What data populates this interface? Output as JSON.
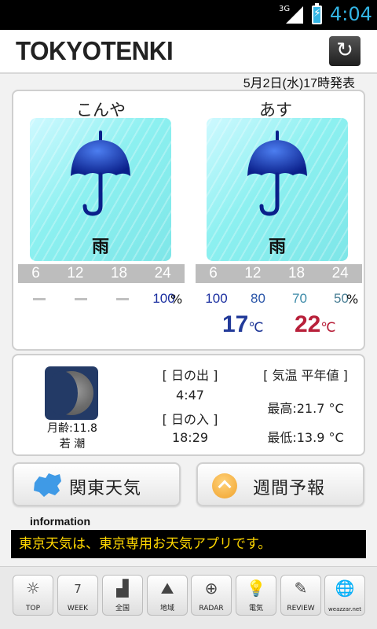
{
  "status_bar": {
    "network": "3G",
    "time": "4:04"
  },
  "header": {
    "title": "TOKYOTENKI",
    "refresh_icon": "refresh-icon"
  },
  "issued": "5月2日(水)17時発表",
  "forecast": {
    "today": {
      "label": "こんや",
      "weather": "雨",
      "icon": "umbrella-icon",
      "hours": [
        "6",
        "12",
        "18",
        "24"
      ],
      "pop": [
        "",
        "",
        "",
        "100"
      ],
      "pop_unit": "%"
    },
    "tomorrow": {
      "label": "あす",
      "weather": "雨",
      "icon": "umbrella-icon",
      "hours": [
        "6",
        "12",
        "18",
        "24"
      ],
      "pop": [
        "100",
        "80",
        "70",
        "50"
      ],
      "pop_unit": "%"
    },
    "min_temp": "17",
    "max_temp": "22",
    "temp_unit": "℃"
  },
  "astro": {
    "moon_age": "月齢:11.8",
    "moon_name": "若 潮",
    "sunrise_label": "[ 日の出 ]",
    "sunrise": "4:47",
    "sunset_label": "[ 日の入 ]",
    "sunset": "18:29",
    "normal_label": "[ 気温 平年値 ]",
    "normal_high": "最高:21.7 °C",
    "normal_low": "最低:13.9 °C"
  },
  "buttons": {
    "kanto": "関東天気",
    "weekly": "週間予報"
  },
  "info": {
    "label": "information",
    "text": "東京天気は、東京専用お天気アプリです。"
  },
  "nav": [
    {
      "label": "TOP",
      "glyph": "☼"
    },
    {
      "label": "WEEK",
      "glyph": "7"
    },
    {
      "label": "全国",
      "glyph": "▟"
    },
    {
      "label": "地域",
      "glyph": "⛰"
    },
    {
      "label": "RADAR",
      "glyph": "⊕"
    },
    {
      "label": "電気",
      "glyph": "💡"
    },
    {
      "label": "REVIEW",
      "glyph": "✎"
    },
    {
      "label": "weazzar.net",
      "glyph": "🌐"
    }
  ],
  "colors": {
    "low_temp": "#223a99",
    "high_temp": "#b8203a",
    "pop_blue": "#1b2fa0",
    "pop_teal": "#3c8aa8",
    "info_text": "#ffd700"
  }
}
